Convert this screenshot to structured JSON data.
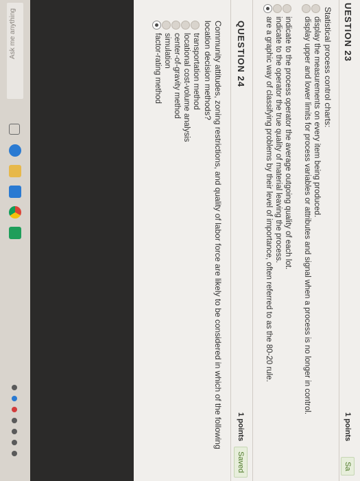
{
  "q23": {
    "header": "UESTION 23",
    "points": "1 points",
    "saved": "Sa",
    "prompt": "Statistical process control charts:",
    "options": [
      {
        "text": "display the measurements on every item being produced.",
        "selected": false
      },
      {
        "text": "display upper and lower limits for process variables or attributes and signal when a process is no longer in control.",
        "selected": false
      },
      {
        "text": "indicate to the process operator the average outgoing quality of each lot.",
        "selected": false
      },
      {
        "text": "indicate to the operator the true quality of material leaving the process.",
        "selected": false
      },
      {
        "text": "are a graphic way of classifying problems by their level of importance, often referred to as the 80-20 rule.",
        "selected": true
      }
    ]
  },
  "q24": {
    "header": "QUESTION 24",
    "points": "1 points",
    "saved": "Saved",
    "prompt": "Community attitudes, zoning restrictions, and quality of labor force are likely to be considered in which of the following location decision methods?",
    "options": [
      {
        "text": "transportation method",
        "selected": false
      },
      {
        "text": "locational cost-volume analysis",
        "selected": false
      },
      {
        "text": "center-of-gravity method",
        "selected": false
      },
      {
        "text": "simulation",
        "selected": false
      },
      {
        "text": "factor-rating method",
        "selected": true
      }
    ]
  },
  "taskbar": {
    "search_placeholder": "Ask me anything",
    "icons": [
      "task-view-icon",
      "edge-icon",
      "file-explorer-icon",
      "store-icon",
      "chrome-icon",
      "app-icon"
    ]
  }
}
